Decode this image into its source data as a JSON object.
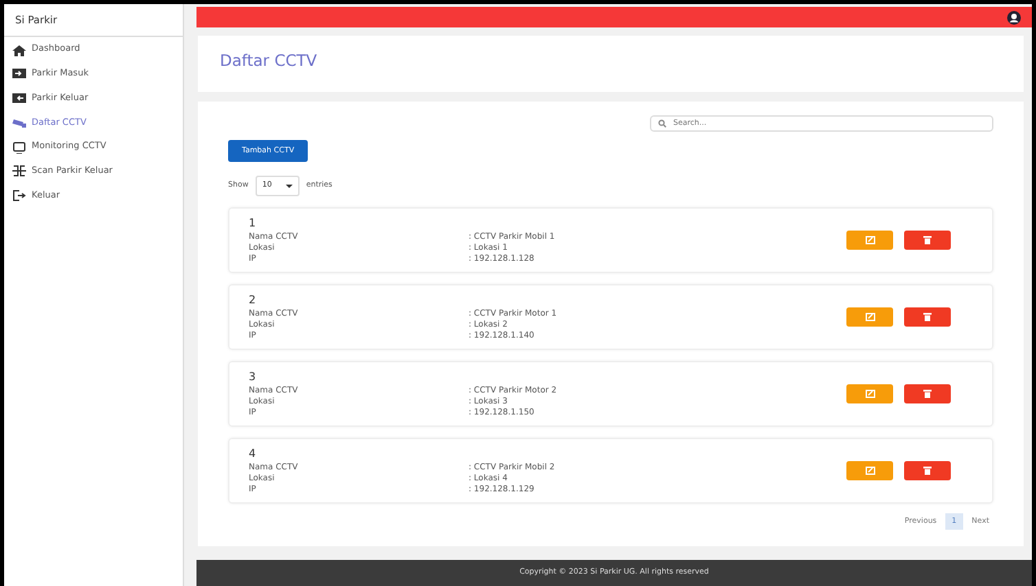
{
  "sidebar": {
    "title": "Si Parkir",
    "items": [
      {
        "label": "Dashboard",
        "selected": false
      },
      {
        "label": "Parkir Masuk",
        "selected": false
      },
      {
        "label": "Parkir Keluar",
        "selected": false
      },
      {
        "label": "Daftar CCTV",
        "selected": true
      },
      {
        "label": "Monitoring CCTV",
        "selected": false
      },
      {
        "label": "Scan Parkir Keluar",
        "selected": false
      },
      {
        "label": "Keluar",
        "selected": false
      }
    ]
  },
  "page_title": "Daftar CCTV",
  "search": {
    "placeholder": "Search..."
  },
  "add_button": "Tambah CCTV",
  "length": {
    "show": "Show",
    "value": "10",
    "entries": "entries"
  },
  "cctvs": [
    {
      "number": "1",
      "fields": [
        {
          "label": "Nama CCTV",
          "value": ": CCTV Parkir Mobil 1"
        },
        {
          "label": "Lokasi",
          "value": ": Lokasi 1"
        },
        {
          "label": "IP",
          "value": ": 192.128.1.128"
        }
      ]
    },
    {
      "number": "2",
      "fields": [
        {
          "label": "Nama CCTV",
          "value": ": CCTV Parkir Motor 1"
        },
        {
          "label": "Lokasi",
          "value": ": Lokasi 2"
        },
        {
          "label": "IP",
          "value": ": 192.128.1.140"
        }
      ]
    },
    {
      "number": "3",
      "fields": [
        {
          "label": "Nama CCTV",
          "value": ": CCTV Parkir Motor 2"
        },
        {
          "label": "Lokasi",
          "value": ": Lokasi 3"
        },
        {
          "label": "IP",
          "value": ": 192.128.1.150"
        }
      ]
    },
    {
      "number": "4",
      "fields": [
        {
          "label": "Nama CCTV",
          "value": ": CCTV Parkir Mobil 2"
        },
        {
          "label": "Lokasi",
          "value": ": Lokasi 4"
        },
        {
          "label": "IP",
          "value": ": 192.128.1.129"
        }
      ]
    }
  ],
  "pagination": [
    {
      "label": "Previous",
      "selected": false
    },
    {
      "label": "1",
      "selected": true
    },
    {
      "label": "Next",
      "selected": false
    }
  ],
  "footer": "Copyright © 2023 Si Parkir UG. All rights reserved"
}
